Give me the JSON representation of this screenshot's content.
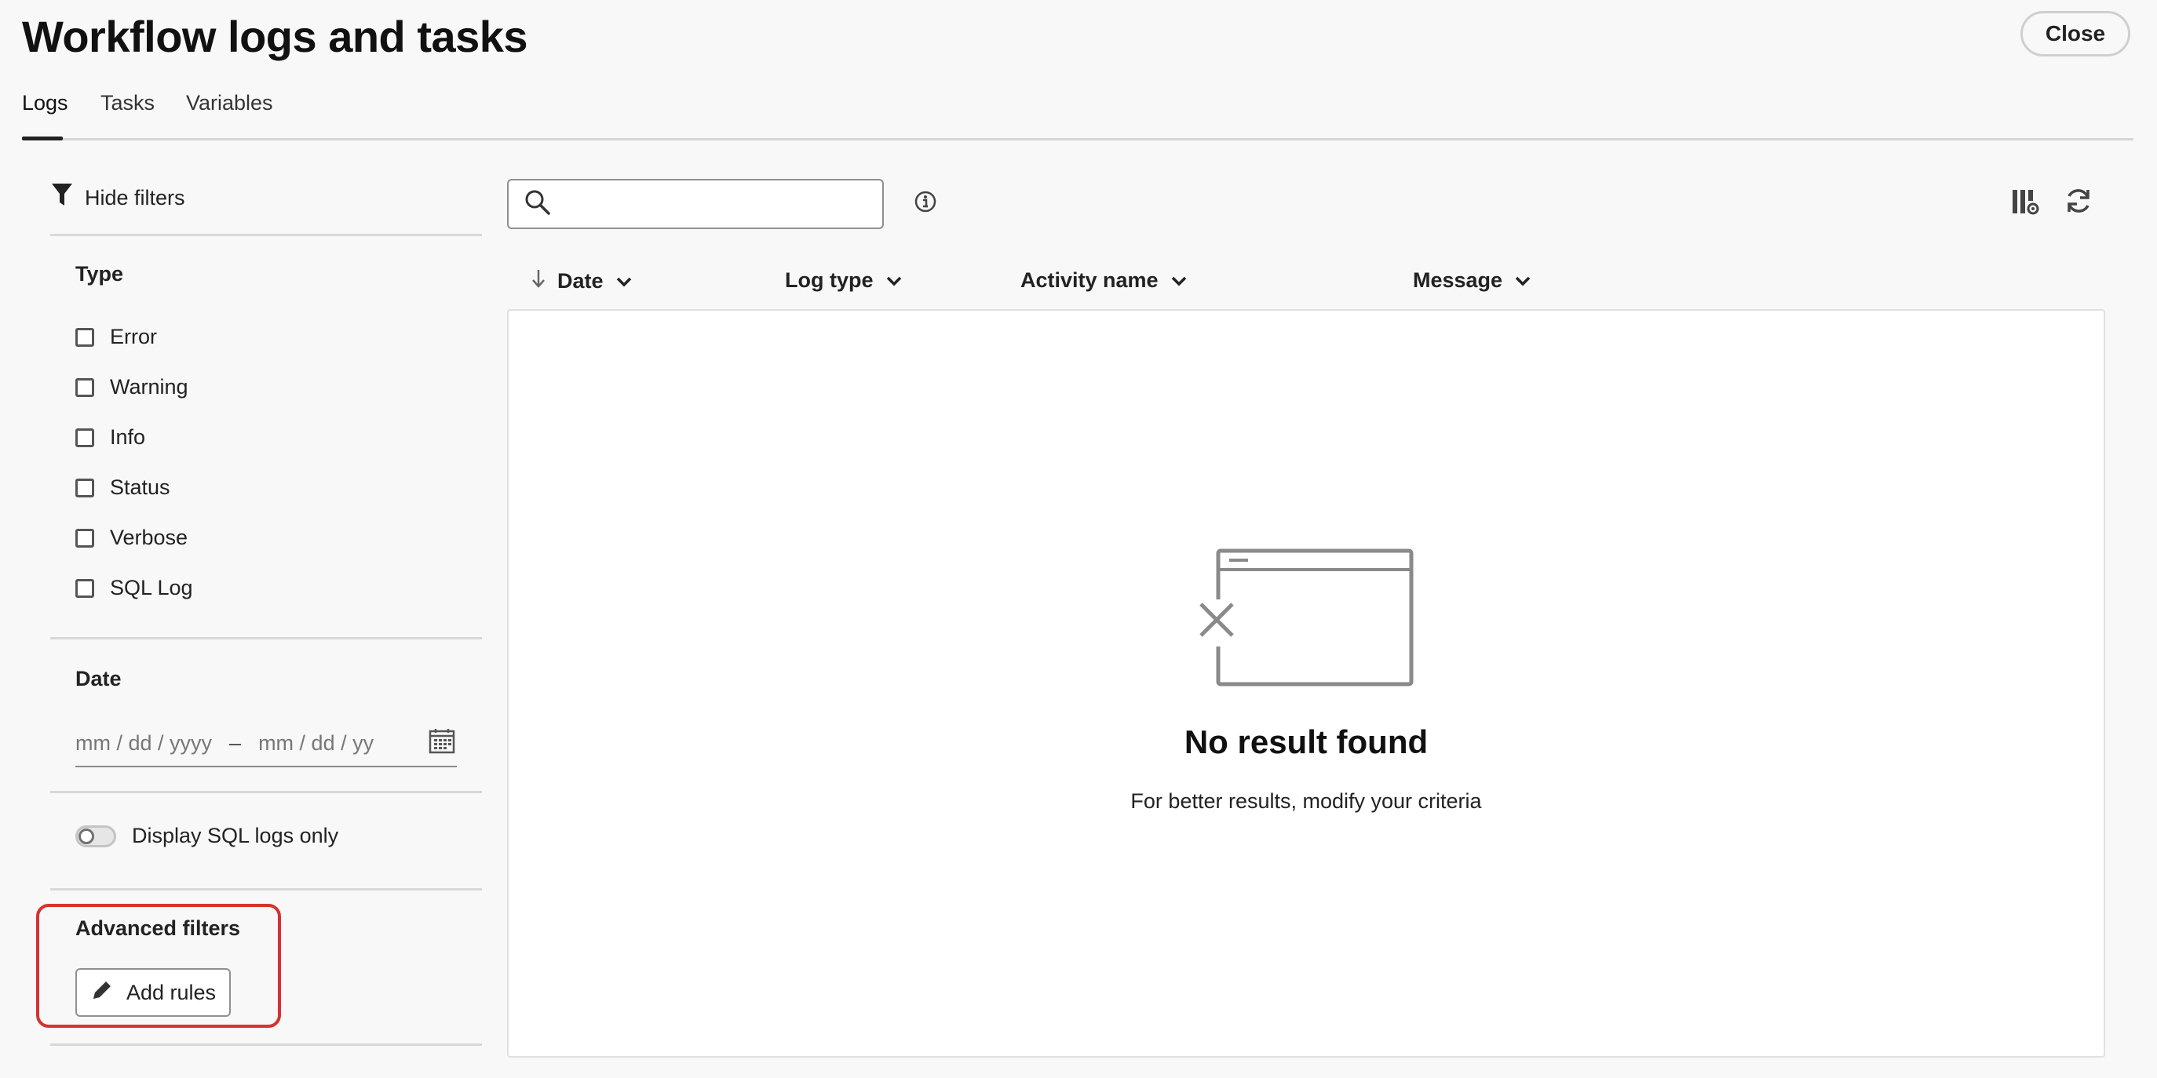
{
  "header": {
    "title": "Workflow logs and tasks",
    "close_label": "Close"
  },
  "tabs": [
    {
      "label": "Logs",
      "selected": true
    },
    {
      "label": "Tasks",
      "selected": false
    },
    {
      "label": "Variables",
      "selected": false
    }
  ],
  "sidebar": {
    "hide_filters_label": "Hide filters",
    "type_section": {
      "title": "Type",
      "options": [
        {
          "label": "Error",
          "checked": false
        },
        {
          "label": "Warning",
          "checked": false
        },
        {
          "label": "Info",
          "checked": false
        },
        {
          "label": "Status",
          "checked": false
        },
        {
          "label": "Verbose",
          "checked": false
        },
        {
          "label": "SQL Log",
          "checked": false
        }
      ]
    },
    "date_section": {
      "title": "Date",
      "start_placeholder": "mm / dd / yyyy",
      "separator": "–",
      "end_placeholder": "mm / dd / yy"
    },
    "sql_toggle": {
      "label": "Display SQL logs only",
      "on": false
    },
    "advanced": {
      "title": "Advanced filters",
      "add_rules_label": "Add rules"
    }
  },
  "main": {
    "search": {
      "value": "",
      "placeholder": ""
    },
    "columns": [
      {
        "label": "Date",
        "sorted": "descending"
      },
      {
        "label": "Log type"
      },
      {
        "label": "Activity name"
      },
      {
        "label": "Message"
      }
    ],
    "empty_state": {
      "title": "No result found",
      "subtitle": "For better results, modify your criteria"
    }
  },
  "icons": {
    "filter": "filter-icon",
    "search": "search-icon",
    "info": "info-icon",
    "columns_settings": "column-settings-icon",
    "refresh": "refresh-icon",
    "calendar": "calendar-icon",
    "edit": "pencil-icon",
    "sort_down": "arrow-down-icon",
    "chevron": "chevron-down-icon",
    "empty": "empty-window-icon"
  },
  "colors": {
    "highlight": "#d6322f",
    "background": "#f8f8f8"
  }
}
